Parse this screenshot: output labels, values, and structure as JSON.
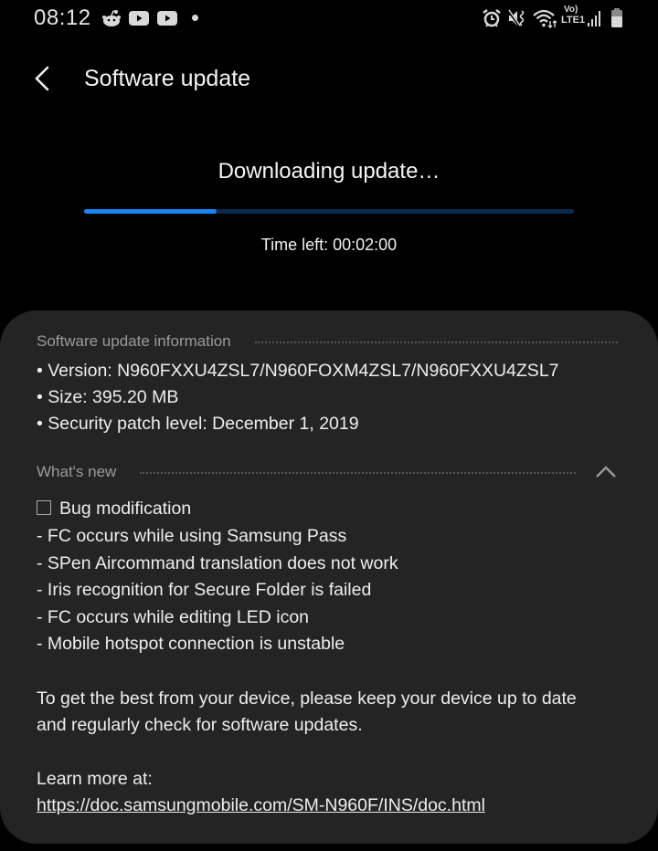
{
  "status_bar": {
    "time": "08:12",
    "left_icons": [
      "reddit-icon",
      "youtube-icon",
      "youtube-icon",
      "notification-dot-icon"
    ],
    "right_icons": [
      "alarm-icon",
      "mute-vibrate-icon",
      "wifi-icon",
      "volte-lte1-icon",
      "signal-icon",
      "battery-icon"
    ],
    "volte_text": "Vo)",
    "lte_text": "LTE1"
  },
  "header": {
    "title": "Software update",
    "back_icon": "chevron-left-icon"
  },
  "download": {
    "title": "Downloading update…",
    "progress_percent": 27,
    "time_left": "Time left: 00:02:00",
    "colors": {
      "fill": "#1a84f5",
      "track": "#0b2a4e"
    }
  },
  "info": {
    "section_label": "Software update information",
    "lines": [
      "• Version: N960FXXU4ZSL7/N960FOXM4ZSL7/N960FXXU4ZSL7",
      "• Size: 395.20 MB",
      "• Security patch level: December 1, 2019"
    ]
  },
  "whats_new": {
    "section_label": "What's new",
    "expanded": true,
    "heading": "Bug modification",
    "items": [
      "- FC occurs while using Samsung Pass",
      "- SPen Aircommand translation does not work",
      "- Iris recognition for Secure Folder is failed",
      "- FC occurs while editing LED icon",
      "- Mobile hotspot connection is unstable"
    ],
    "advice_line1": "To get the best from your device, please keep your device up to date",
    "advice_line2": "and regularly check for software updates.",
    "learn_more": "Learn more at:",
    "link": "https://doc.samsungmobile.com/SM-N960F/INS/doc.html"
  }
}
